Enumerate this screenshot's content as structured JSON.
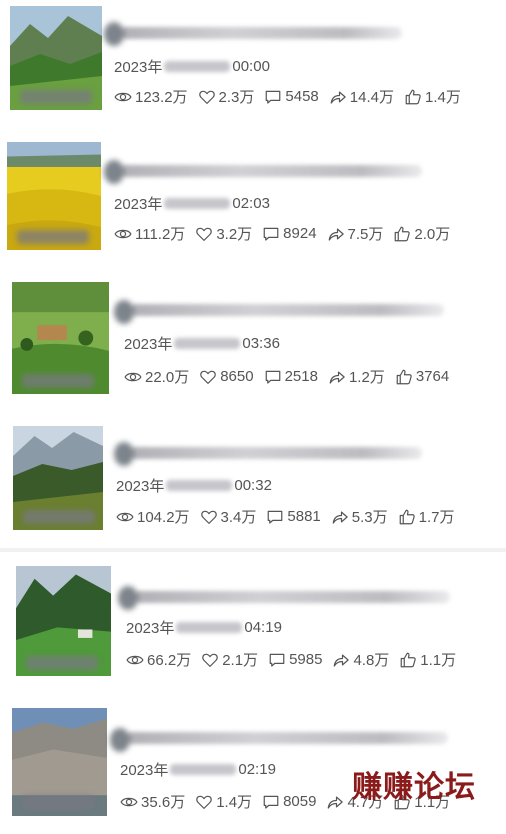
{
  "posts": [
    {
      "time_prefix": "2023年",
      "time_suffix": "00:00",
      "views": "123.2万",
      "likes": "2.3万",
      "comments": "5458",
      "shares": "14.4万",
      "thumbs": "1.4万"
    },
    {
      "time_prefix": "2023年",
      "time_suffix": "02:03",
      "views": "111.2万",
      "likes": "3.2万",
      "comments": "8924",
      "shares": "7.5万",
      "thumbs": "2.0万"
    },
    {
      "time_prefix": "2023年",
      "time_suffix": "03:36",
      "views": "22.0万",
      "likes": "8650",
      "comments": "2518",
      "shares": "1.2万",
      "thumbs": "3764"
    },
    {
      "time_prefix": "2023年",
      "time_suffix": "00:32",
      "views": "104.2万",
      "likes": "3.4万",
      "comments": "5881",
      "shares": "5.3万",
      "thumbs": "1.7万"
    },
    {
      "time_prefix": "2023年",
      "time_suffix": "04:19",
      "views": "66.2万",
      "likes": "2.1万",
      "comments": "5985",
      "shares": "4.8万",
      "thumbs": "1.1万"
    },
    {
      "time_prefix": "2023年",
      "time_suffix": "02:19",
      "views": "35.6万",
      "likes": "1.4万",
      "comments": "8059",
      "shares": "4.7万",
      "thumbs": "1.1万"
    }
  ],
  "watermark": "赚赚论坛",
  "icons": [
    "eye-icon",
    "heart-icon",
    "comment-icon",
    "share-icon",
    "thumbs-up-icon"
  ]
}
